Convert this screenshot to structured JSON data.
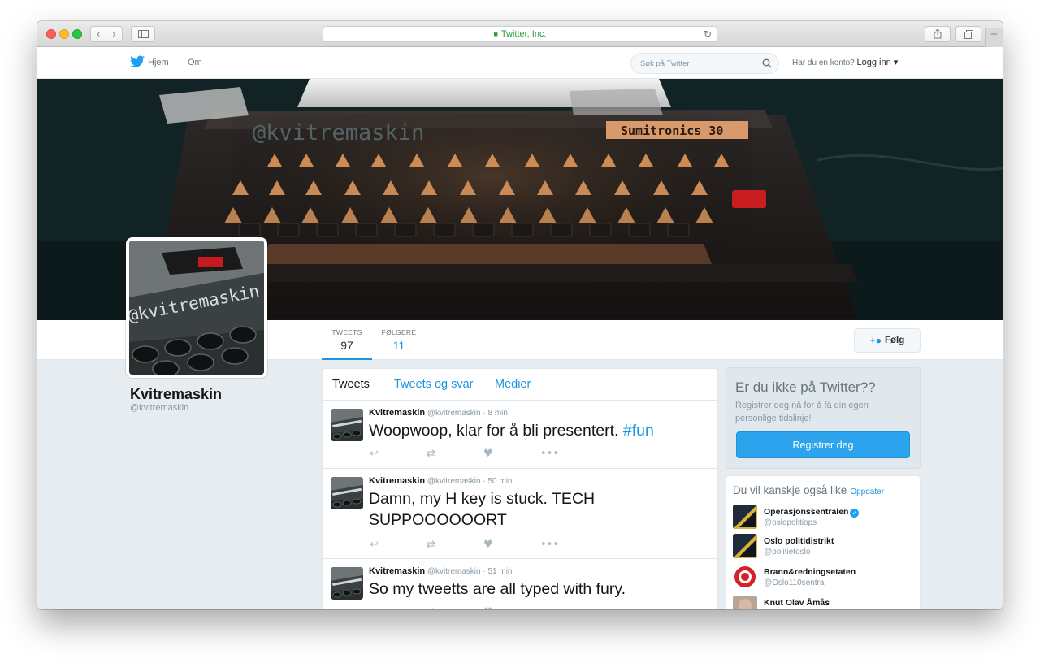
{
  "browser": {
    "address_text": "Twitter, Inc.",
    "back_icon": "‹",
    "forward_icon": "›",
    "reload_icon": "↻",
    "new_tab_icon": "+"
  },
  "nav": {
    "home_label": "Hjem",
    "about_label": "Om",
    "search_placeholder": "Søk på Twitter",
    "account_question": "Har du en konto?",
    "login_label": "Logg inn ▾"
  },
  "profile": {
    "name": "Kvitremaskin",
    "handle": "@kvitremaskin",
    "banner_handle_text": "@kvitremaskin",
    "banner_brand_text": "Sumitronics 30",
    "avatar_text": "@kvitremaskin",
    "stats": [
      {
        "label": "TWEETS",
        "value": "97"
      },
      {
        "label": "FØLGERE",
        "value": "11"
      }
    ],
    "follow_label": "Følg"
  },
  "timeline": {
    "tabs": [
      "Tweets",
      "Tweets og svar",
      "Medier"
    ],
    "tweets": [
      {
        "name": "Kvitremaskin",
        "handle": "@kvitremaskin",
        "time": "· 8 min",
        "text": "Woopwoop, klar for å bli presentert.",
        "hashtag": "#fun"
      },
      {
        "name": "Kvitremaskin",
        "handle": "@kvitremaskin",
        "time": "· 50 min",
        "text": "Damn, my H key is stuck. TECH SUPPOOOOOORT",
        "hashtag": ""
      },
      {
        "name": "Kvitremaskin",
        "handle": "@kvitremaskin",
        "time": "· 51 min",
        "text": "So my tweetts are all typed with fury.",
        "hashtag": ""
      }
    ]
  },
  "signup": {
    "title": "Er du ikke på Twitter??",
    "description": "Registrer deg nå for å få din egen personlige tidslinje!",
    "button_label": "Registrer deg"
  },
  "suggestions": {
    "title": "Du vil kanskje også like",
    "refresh_label": "Oppdater",
    "items": [
      {
        "name": "Operasjonssentralen",
        "handle": "@oslopolitiops",
        "verified": true
      },
      {
        "name": "Oslo politidistrikt",
        "handle": "@politietoslo",
        "verified": false
      },
      {
        "name": "Brann&redningsetaten",
        "handle": "@Oslo110sentral",
        "verified": false
      },
      {
        "name": "Knut Olav Åmås",
        "handle": "",
        "verified": false
      }
    ]
  },
  "colors": {
    "twitter_blue": "#1b95e0",
    "signup_button": "#2ba3ed",
    "page_background": "#e6ecf0"
  }
}
